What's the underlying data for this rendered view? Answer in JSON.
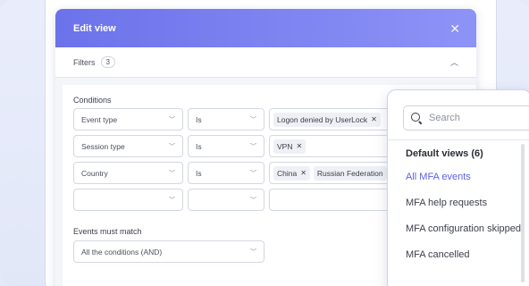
{
  "dialog": {
    "title": "Edit view",
    "close_icon": "close-icon",
    "filters": {
      "label": "Filters",
      "count": "3",
      "toggle_icon": "chevron-up-icon"
    },
    "conditions_label": "Conditions",
    "rows": [
      {
        "field": "Event type",
        "operator": "Is",
        "values": [
          "Logon denied by UserLock"
        ]
      },
      {
        "field": "Session type",
        "operator": "Is",
        "values": [
          "VPN"
        ]
      },
      {
        "field": "Country",
        "operator": "Is",
        "values": [
          "China",
          "Russian Federation"
        ]
      },
      {
        "field": "",
        "operator": "",
        "values": []
      }
    ],
    "match_label": "Events must match",
    "match_value": "All the conditions (AND)"
  },
  "popup": {
    "search_placeholder": "Search",
    "group_title": "Default views (6)",
    "items": [
      "All MFA events",
      "MFA help requests",
      "MFA configuration skipped",
      "MFA cancelled"
    ],
    "active_index": 0,
    "accent": "#5b61e6"
  },
  "colors": {
    "header_start": "#6c72ea",
    "header_end": "#8d93f6"
  }
}
